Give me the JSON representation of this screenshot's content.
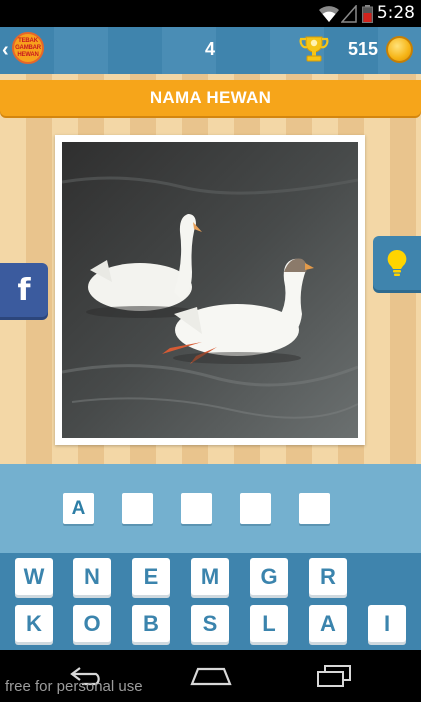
{
  "status_bar": {
    "time": "5:28",
    "icons": [
      "wifi-icon",
      "signal-icon",
      "battery-low-icon"
    ]
  },
  "header": {
    "back_icon": "chevron-left-icon",
    "logo_lines": [
      "TEBAK",
      "GAMBAR",
      "HEWAN"
    ],
    "level": "4",
    "trophy_icon": "trophy-icon",
    "coins": "515",
    "coin_icon": "coin-icon"
  },
  "category_title": "NAMA HEWAN",
  "side_buttons": {
    "facebook_label": "f",
    "hint_icon": "lightbulb-icon"
  },
  "answer_slots": [
    "A",
    "",
    "",
    "",
    ""
  ],
  "letter_keys": {
    "row1": [
      "W",
      "N",
      "E",
      "M",
      "G",
      "R"
    ],
    "row2": [
      "K",
      "O",
      "B",
      "S",
      "L",
      "A",
      "I"
    ]
  },
  "navbar": {
    "icons": [
      "back-nav-icon",
      "home-nav-icon",
      "recents-nav-icon"
    ],
    "watermark": "free for personal use"
  },
  "colors": {
    "header_blue": "#3f84ad",
    "title_orange": "#f6a51a",
    "answer_blue": "#74b0cf",
    "facebook_blue": "#3b5b9e"
  }
}
